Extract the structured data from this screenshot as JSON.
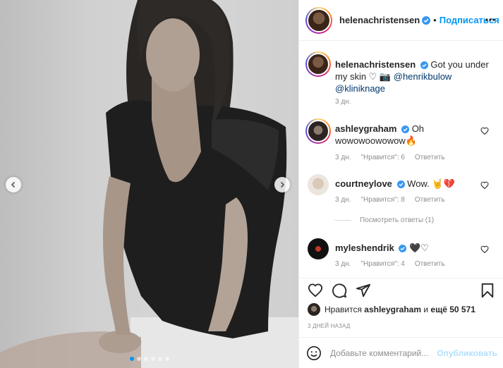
{
  "post": {
    "image_alt": "",
    "carousel": {
      "count": 6,
      "active_index": 0
    }
  },
  "header": {
    "username": "helenachristensen",
    "separator": "•",
    "follow_label": "Подписаться"
  },
  "caption": {
    "username": "helenachristensen",
    "text": "Got you under my skin ♡ 📷",
    "mention1": "@henrikbulow",
    "mention2": "@kliniknage",
    "time": "3 дн."
  },
  "comments": [
    {
      "username": "ashleygraham",
      "line1": "Oh",
      "line2": "wowowoowowow🔥",
      "time": "3 дн.",
      "likes": "\"Нравится\": 6",
      "reply": "Ответить"
    },
    {
      "username": "courtneylove",
      "text": "Wow. 🤘💔",
      "time": "3 дн.",
      "likes": "\"Нравится\": 8",
      "reply": "Ответить"
    },
    {
      "username": "myleshendrik",
      "text": "🖤♡",
      "time": "3 дн.",
      "likes": "\"Нравится\": 4",
      "reply": "Ответить"
    }
  ],
  "replies_label": "Посмотреть ответы (1)",
  "likes": {
    "prefix": "Нравится",
    "user": "ashleygraham",
    "middle": "и",
    "rest": "ещё 50 571"
  },
  "date": "3 ДНЕЙ НАЗАД",
  "comment_box": {
    "placeholder": "Добавьте комментарий...",
    "publish": "Опубликовать"
  },
  "colors": {
    "link": "#0095f6",
    "verified": "#3897f0",
    "muted": "#8e8e8e"
  }
}
